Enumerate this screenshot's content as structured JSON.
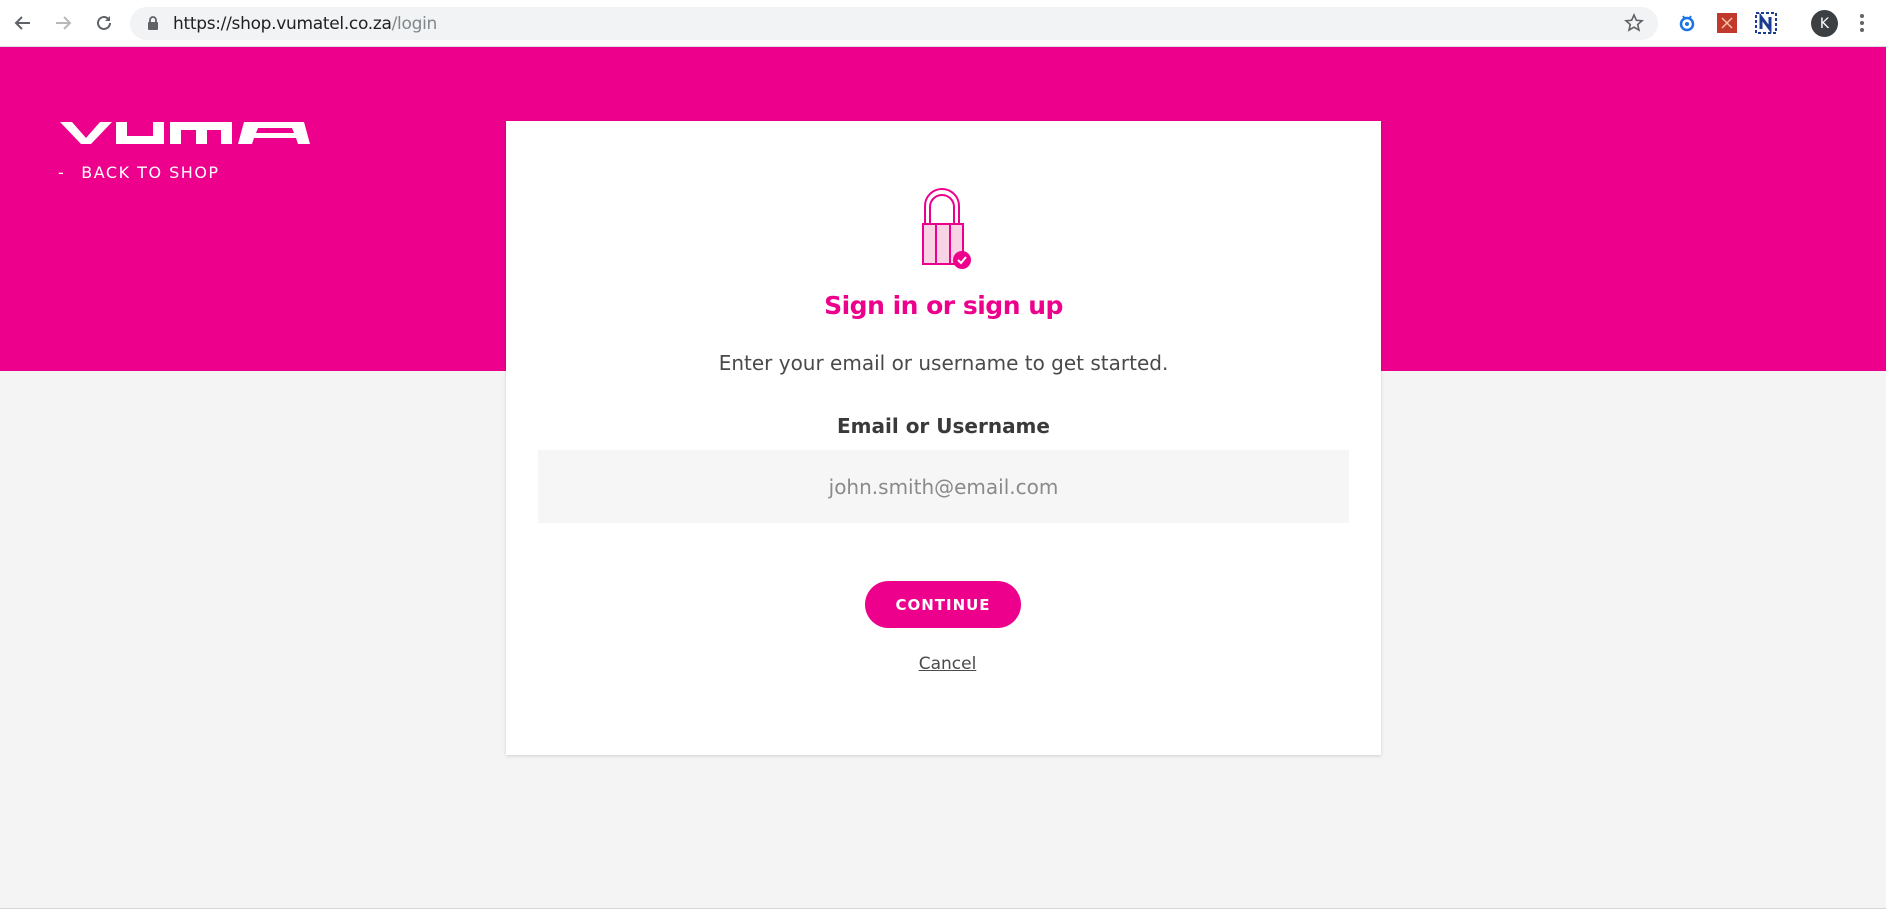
{
  "browser": {
    "url_host": "https://shop.vumatel.co.za",
    "url_path": "/login",
    "profile_initial": "K"
  },
  "header": {
    "back_dash": "-",
    "back_link": "BACK TO SHOP"
  },
  "login": {
    "title": "Sign in or sign up",
    "subtitle": "Enter your email or username to get started.",
    "field_label": "Email or Username",
    "email_placeholder": "john.smith@email.com",
    "email_value": "",
    "continue_label": "CONTINUE",
    "cancel_label": "Cancel"
  },
  "colors": {
    "brand_pink": "#ec008c",
    "page_gray": "#f4f4f4"
  },
  "icons": [
    "back-arrow-icon",
    "forward-arrow-icon",
    "reload-icon",
    "lock-icon",
    "star-icon",
    "extension-icon",
    "menu-icon",
    "padlock-icon",
    "vuma-logo"
  ]
}
